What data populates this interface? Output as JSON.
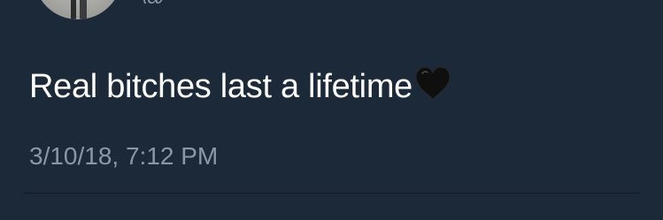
{
  "tweet": {
    "text": "Real bitches last a lifetime",
    "emoji": "black-heart",
    "timestamp": "3/10/18, 7:12 PM"
  },
  "colors": {
    "background": "#1c2938",
    "text": "#ffffff",
    "secondary": "#8899a6"
  }
}
